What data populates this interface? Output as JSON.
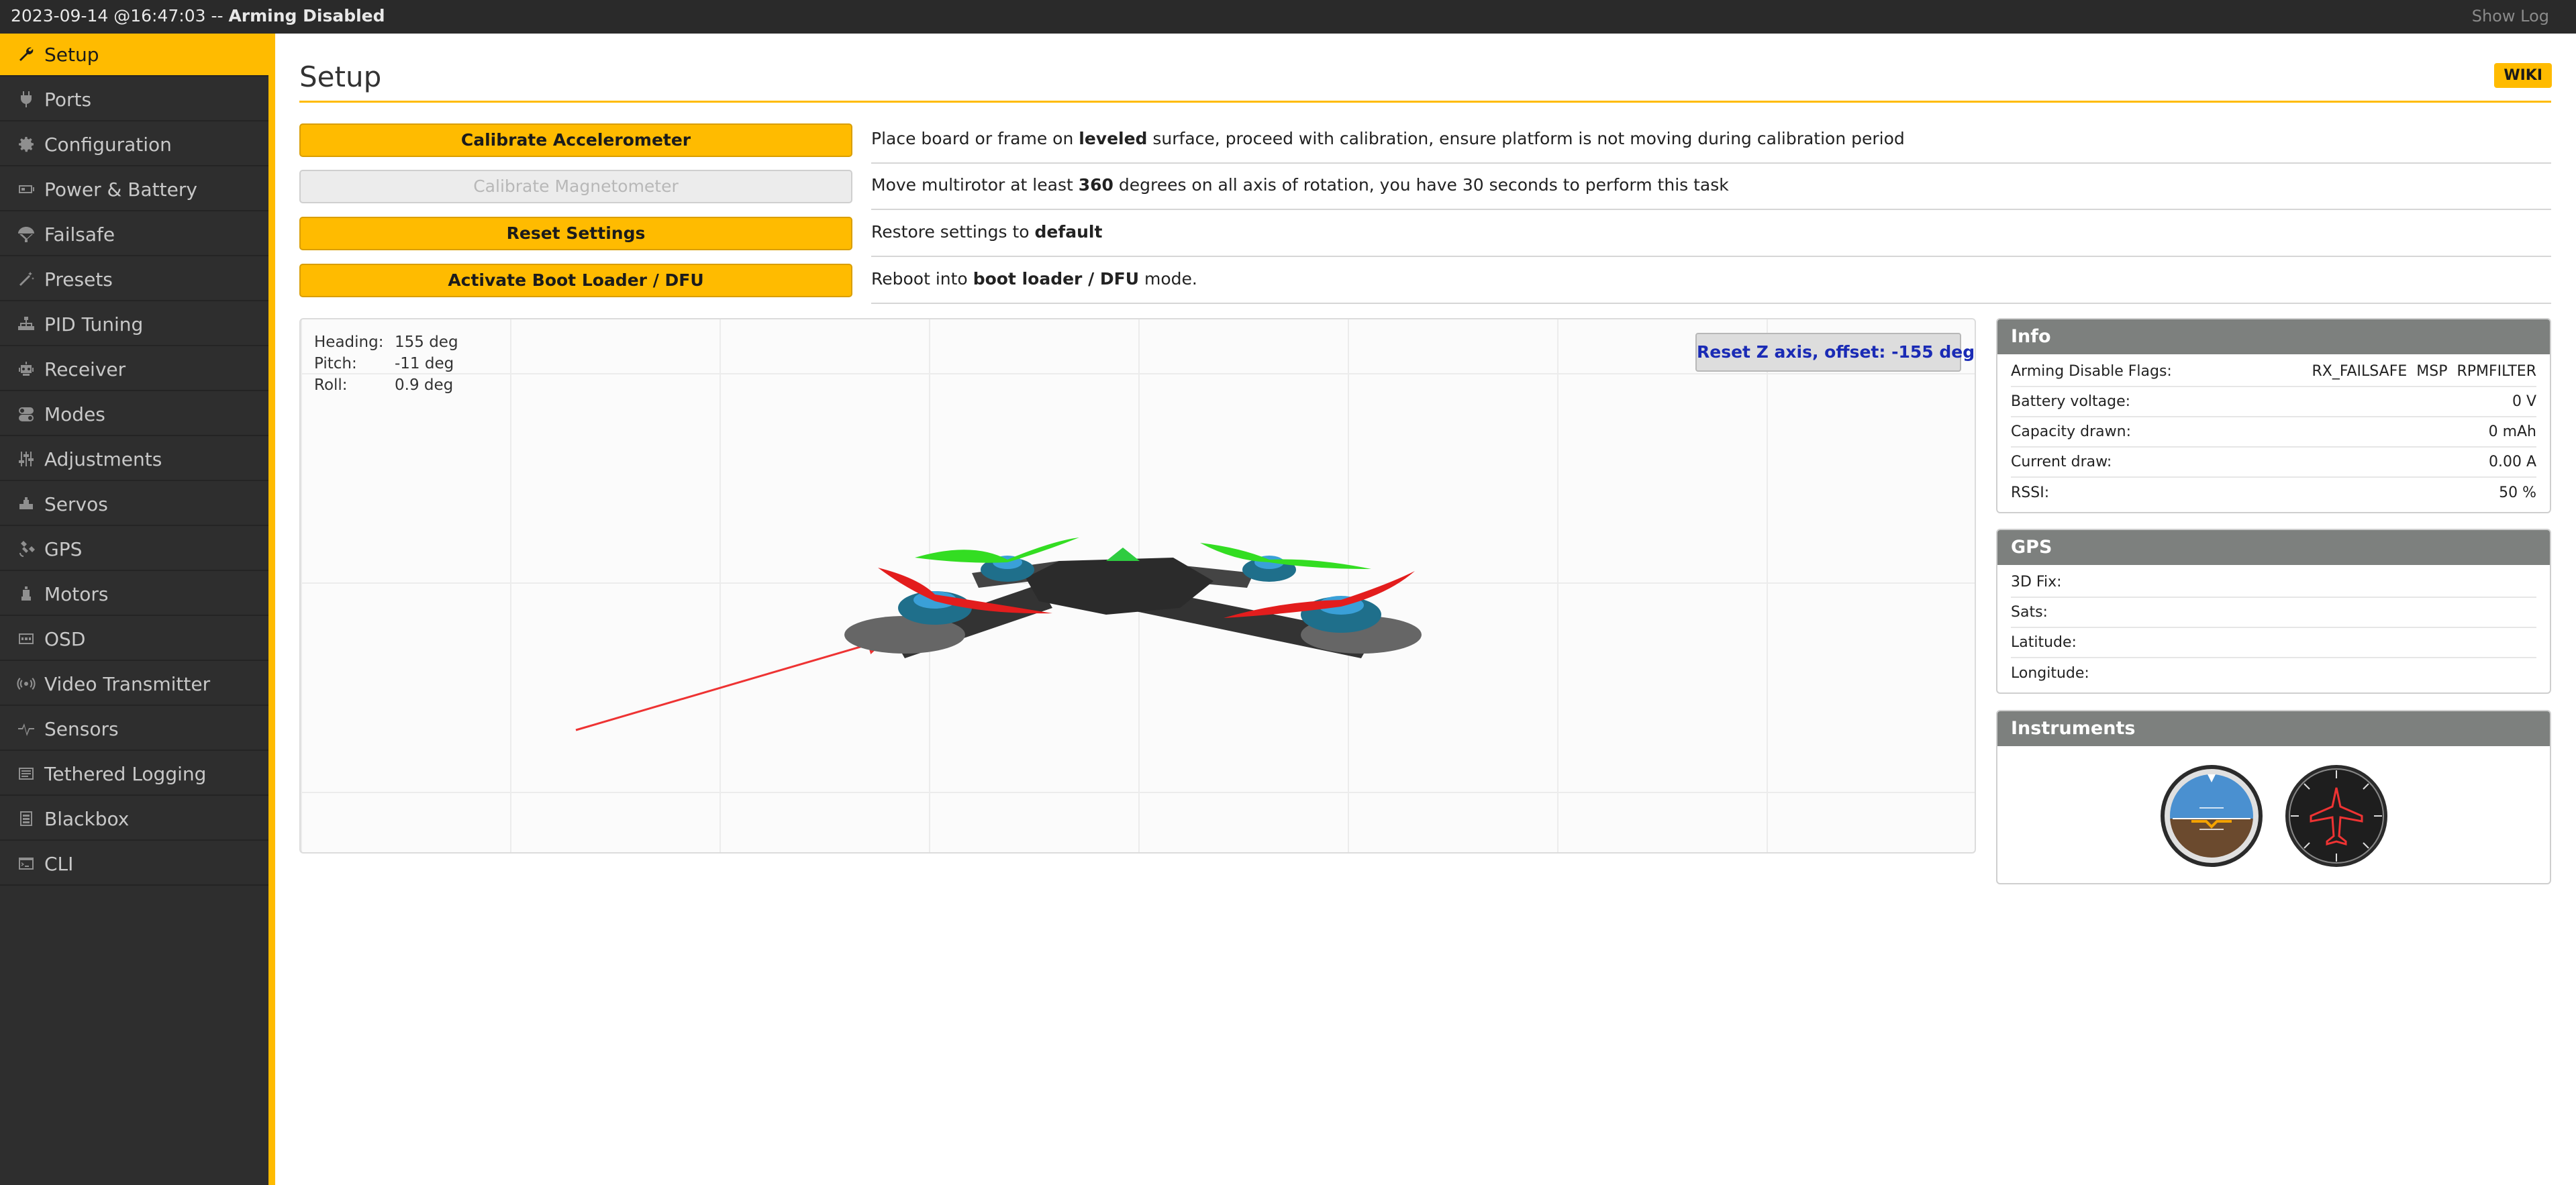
{
  "topbar": {
    "datetime": "2023-09-14 @16:47:03 -- ",
    "state": "Arming Disabled",
    "show_log": "Show Log"
  },
  "sidebar": {
    "items": [
      {
        "label": "Setup",
        "icon": "wrench-icon",
        "active": true
      },
      {
        "label": "Ports",
        "icon": "plug-icon"
      },
      {
        "label": "Configuration",
        "icon": "gear-icon"
      },
      {
        "label": "Power & Battery",
        "icon": "battery-icon"
      },
      {
        "label": "Failsafe",
        "icon": "parachute-icon"
      },
      {
        "label": "Presets",
        "icon": "magic-wand-icon"
      },
      {
        "label": "PID Tuning",
        "icon": "sitemap-icon"
      },
      {
        "label": "Receiver",
        "icon": "robot-icon"
      },
      {
        "label": "Modes",
        "icon": "toggle-icon"
      },
      {
        "label": "Adjustments",
        "icon": "sliders-icon"
      },
      {
        "label": "Servos",
        "icon": "servo-icon"
      },
      {
        "label": "GPS",
        "icon": "satellite-icon"
      },
      {
        "label": "Motors",
        "icon": "motor-icon"
      },
      {
        "label": "OSD",
        "icon": "osd-icon"
      },
      {
        "label": "Video Transmitter",
        "icon": "broadcast-icon"
      },
      {
        "label": "Sensors",
        "icon": "pulse-icon"
      },
      {
        "label": "Tethered Logging",
        "icon": "log-icon"
      },
      {
        "label": "Blackbox",
        "icon": "blackbox-icon"
      },
      {
        "label": "CLI",
        "icon": "terminal-icon"
      }
    ]
  },
  "main": {
    "title": "Setup",
    "wiki": "WIKI",
    "actions": [
      {
        "button": "Calibrate Accelerometer",
        "disabled": false,
        "desc": [
          {
            "t": "Place board or frame on "
          },
          {
            "t": "leveled",
            "b": true
          },
          {
            "t": " surface, proceed with calibration, ensure platform is not moving during calibration period"
          }
        ]
      },
      {
        "button": "Calibrate Magnetometer",
        "disabled": true,
        "desc": [
          {
            "t": "Move multirotor at least "
          },
          {
            "t": "360",
            "b": true
          },
          {
            "t": " degrees on all axis of rotation, you have 30 seconds to perform this task"
          }
        ]
      },
      {
        "button": "Reset Settings",
        "disabled": false,
        "desc": [
          {
            "t": "Restore settings to "
          },
          {
            "t": "default",
            "b": true
          }
        ]
      },
      {
        "button": "Activate Boot Loader / DFU",
        "disabled": false,
        "desc": [
          {
            "t": "Reboot into "
          },
          {
            "t": "boot loader / DFU",
            "b": true
          },
          {
            "t": " mode."
          }
        ]
      }
    ],
    "attitude": {
      "heading_label": "Heading:",
      "heading_value": "155 deg",
      "pitch_label": "Pitch:",
      "pitch_value": "-11 deg",
      "roll_label": "Roll:",
      "roll_value": "0.9 deg"
    },
    "reset_z": "Reset Z axis, offset: -155 deg"
  },
  "info": {
    "title": "Info",
    "rows": [
      {
        "label": "Arming Disable Flags:",
        "value": "RX_FAILSAFE  MSP  RPMFILTER"
      },
      {
        "label": "Battery voltage:",
        "value": "0 V"
      },
      {
        "label": "Capacity drawn:",
        "value": "0 mAh"
      },
      {
        "label": "Current draw:",
        "value": "0.00 A"
      },
      {
        "label": "RSSI:",
        "value": "50 %"
      }
    ]
  },
  "gps": {
    "title": "GPS",
    "rows": [
      {
        "label": "3D Fix:",
        "value": ""
      },
      {
        "label": "Sats:",
        "value": ""
      },
      {
        "label": "Latitude:",
        "value": ""
      },
      {
        "label": "Longitude:",
        "value": ""
      }
    ]
  },
  "instruments": {
    "title": "Instruments",
    "gauges": [
      "attitude-indicator-icon",
      "heading-indicator-icon"
    ]
  },
  "colors": {
    "accent": "#ffbb00",
    "sidebar_bg": "#2e2e2e",
    "panel_header": "#7d807e",
    "reset_text": "#1a2bb5"
  }
}
